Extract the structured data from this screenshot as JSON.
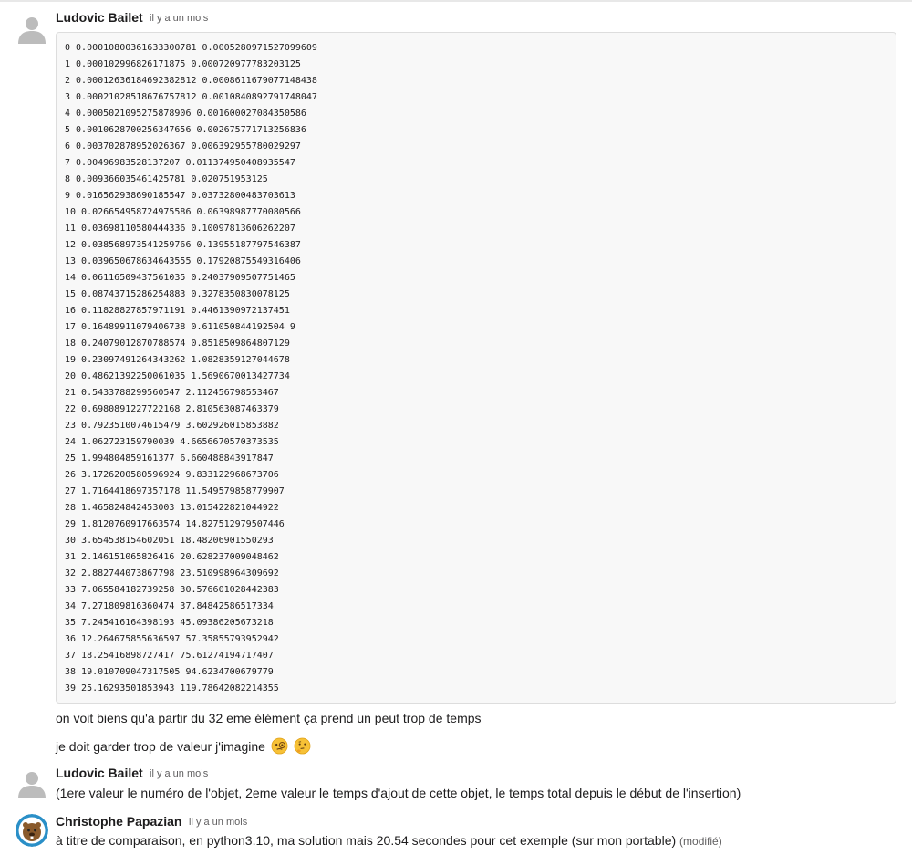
{
  "messages": [
    {
      "author": "Ludovic Bailet",
      "time": "il y a un mois",
      "code_lines": [
        "0 0.00010800361633300781 0.0005280971527099609",
        "1 0.000102996826171875 0.000720977783203125",
        "2 0.00012636184692382812 0.0008611679077148438",
        "3 0.00021028518676757812 0.0010840892791748047",
        "4 0.0005021095275878906 0.001600027084350586",
        "5 0.0010628700256347656 0.002675771713256836",
        "6 0.003702878952026367 0.006392955780029297",
        "7 0.00496983528137207 0.011374950408935547",
        "8 0.009366035461425781 0.020751953125",
        "9 0.016562938690185547 0.03732800483703613",
        "10 0.026654958724975586 0.06398987770080566",
        "11 0.03698110580444336 0.10097813606262207",
        "12 0.038568973541259766 0.13955187797546387",
        "13 0.039650678634643555 0.17920875549316406",
        "14 0.06116509437561035 0.24037909507751465",
        "15 0.08743715286254883 0.3278350830078125",
        "16 0.11828827857971191 0.4461390972137451",
        "17 0.16489911079406738 0.611050844192504 9",
        "18 0.24079012870788574 0.8518509864807129",
        "19 0.23097491264343262 1.0828359127044678",
        "20 0.48621392250061035 1.5690670013427734",
        "21 0.5433788299560547 2.112456798553467",
        "22 0.6980891227722168 2.810563087463379",
        "23 0.7923510074615479 3.602926015853882",
        "24 1.062723159790039 4.6656670570373535",
        "25 1.994804859161377 6.660488843917847",
        "26 3.1726200580596924 9.833122968673706",
        "27 1.7164418697357178 11.549579858779907",
        "28 1.465824842453003 13.015422821044922",
        "29 1.8120760917663574 14.827512979507446",
        "30 3.654538154602051 18.48206901550293",
        "31 2.146151065826416 20.628237009048462",
        "32 2.882744073867798 23.510998964309692",
        "33 7.065584182739258 30.576601028442383",
        "34 7.271809816360474 37.84842586517334",
        "35 7.245416164398193 45.09386205673218",
        "36 12.264675855636597 57.35855793952942",
        "37 18.25416898727417 75.61274194717407",
        "38 19.010709047317505 94.6234700679779",
        "39 25.16293501853943 119.78642082214355"
      ],
      "follow_up_1": "on voit biens qu'a partir du 32 eme élément ça prend un peut trop de temps",
      "follow_up_2": "je doit garder trop de valeur j'imagine"
    },
    {
      "author": "Ludovic Bailet",
      "time": "il y a un mois",
      "text": "(1ere valeur le numéro de l'objet, 2eme valeur le temps d'ajout de cette objet, le temps total depuis le début de l'insertion)"
    },
    {
      "author": "Christophe Papazian",
      "time": "il y a un mois",
      "text": "à titre de comparaison, en python3.10, ma solution mais 20.54 secondes pour cet exemple (sur mon portable)",
      "edited": "(modifié)"
    }
  ],
  "icons": {
    "emoji_1": "face-with-monocle-icon",
    "emoji_2": "thinking-face-icon"
  },
  "colors": {
    "author_text": "#1d1c1d",
    "timestamp_text": "#616061",
    "code_background": "#f8f8f8",
    "code_border": "#dddddd"
  }
}
